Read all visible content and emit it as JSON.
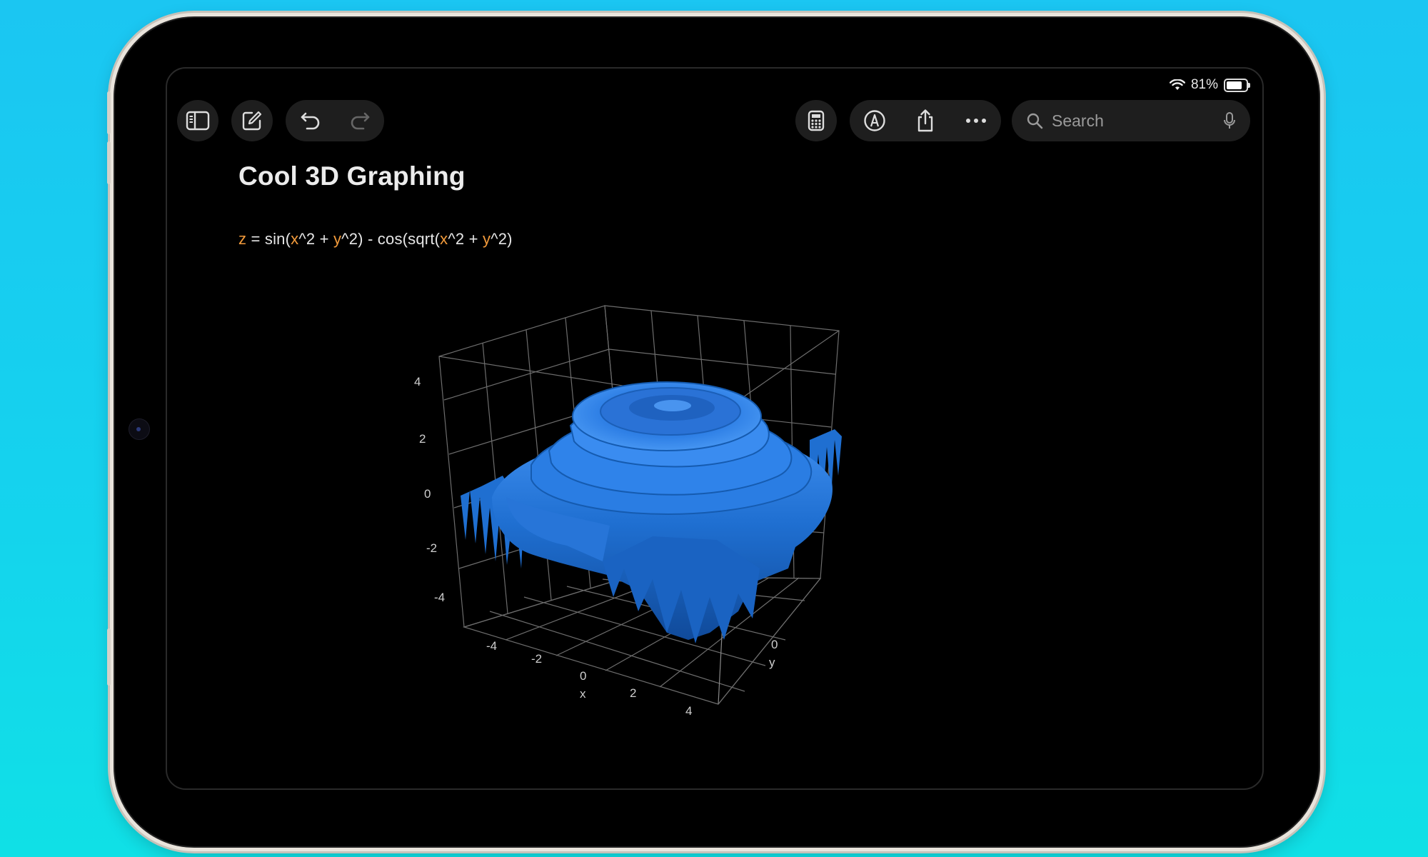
{
  "status_bar": {
    "battery": "81%"
  },
  "toolbar": {
    "search_placeholder": "Search"
  },
  "note": {
    "title": "Cool 3D Graphing",
    "equation": {
      "z": "z",
      "part1": " = sin(",
      "x1": "x",
      "part2": "^2 + ",
      "y1": "y",
      "part3": "^2) - cos(sqrt(",
      "x2": "x",
      "part4": "^2 + ",
      "y2": "y",
      "part5": "^2)"
    }
  },
  "chart_data": {
    "type": "surface",
    "function": "z = sin(x^2 + y^2) - cos(sqrt(x^2 + y^2))",
    "xlabel": "x",
    "ylabel": "y",
    "zlabel": "",
    "x_ticks": [
      "-4",
      "-2",
      "0",
      "2",
      "4"
    ],
    "y_ticks": [
      "0"
    ],
    "z_ticks": [
      "4",
      "2",
      "0",
      "-2",
      "-4"
    ],
    "xlim": [
      -5,
      5
    ],
    "ylim": [
      -5,
      5
    ],
    "zlim": [
      -5,
      5
    ],
    "grid": true,
    "surface_color": "#1f6fd1"
  }
}
